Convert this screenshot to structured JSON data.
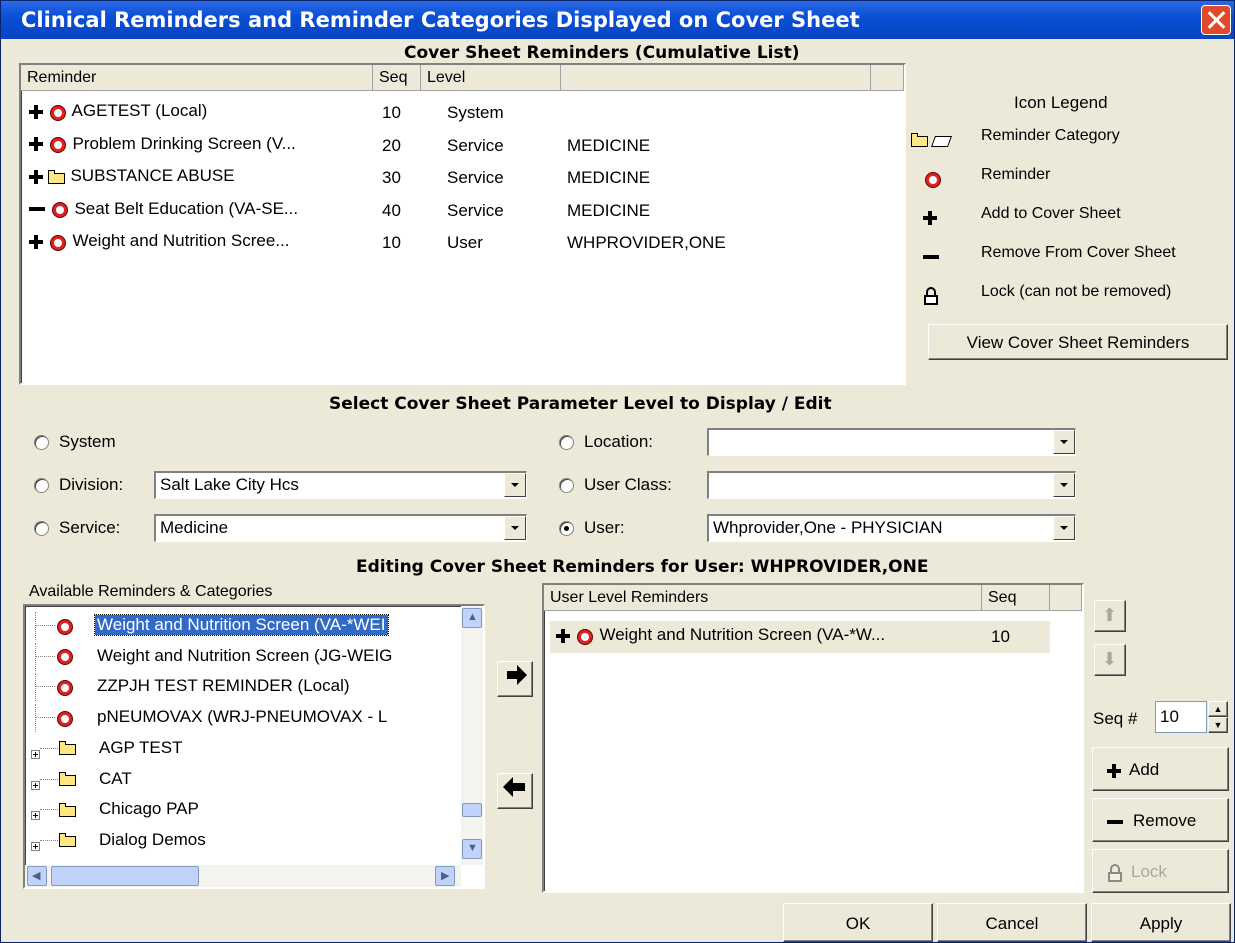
{
  "window": {
    "title": "Clinical Reminders and Reminder Categories Displayed on Cover Sheet"
  },
  "cumulative": {
    "heading": "Cover Sheet Reminders (Cumulative List)",
    "columns": [
      "Reminder",
      "Seq",
      "Level",
      ""
    ],
    "rows": [
      {
        "action": "add",
        "icon": "reminder-clock-icon",
        "name": "AGETEST (Local)",
        "seq": "10",
        "level": "System",
        "value": ""
      },
      {
        "action": "add",
        "icon": "reminder-clock-icon",
        "name": "Problem Drinking Screen (V...",
        "seq": "20",
        "level": "Service",
        "value": "MEDICINE"
      },
      {
        "action": "add",
        "icon": "folder-icon",
        "name": "SUBSTANCE ABUSE",
        "seq": "30",
        "level": "Service",
        "value": "MEDICINE"
      },
      {
        "action": "remove",
        "icon": "reminder-clock-icon",
        "name": "Seat Belt Education (VA-SE...",
        "seq": "40",
        "level": "Service",
        "value": "MEDICINE"
      },
      {
        "action": "add",
        "icon": "reminder-clock-icon",
        "name": "Weight and Nutrition Scree...",
        "seq": "10",
        "level": "User",
        "value": "WHPROVIDER,ONE"
      }
    ]
  },
  "legend": {
    "title": "Icon Legend",
    "items": [
      {
        "icon": "folder-icon",
        "label": "Reminder Category"
      },
      {
        "icon": "reminder-clock-icon",
        "label": "Reminder"
      },
      {
        "icon": "plus-icon",
        "label": "Add to Cover Sheet"
      },
      {
        "icon": "minus-icon",
        "label": "Remove From Cover Sheet"
      },
      {
        "icon": "lock-icon",
        "label": "Lock (can not be removed)"
      }
    ],
    "view_button": "View Cover Sheet Reminders"
  },
  "params": {
    "heading": "Select Cover Sheet Parameter Level to Display / Edit",
    "system_label": "System",
    "division_label": "Division:",
    "division_value": "Salt Lake City Hcs",
    "service_label": "Service:",
    "service_value": "Medicine",
    "location_label": "Location:",
    "location_value": "",
    "userclass_label": "User Class:",
    "userclass_value": "",
    "user_label": "User:",
    "user_value": "Whprovider,One - PHYSICIAN",
    "selected": "User"
  },
  "editing": {
    "heading": "Editing Cover Sheet Reminders for User: WHPROVIDER,ONE",
    "available_label": "Available Reminders & Categories",
    "available": [
      {
        "icon": "reminder-clock-icon",
        "label": "Weight and Nutrition Screen (VA-*WEI",
        "selected": true,
        "expander": false
      },
      {
        "icon": "reminder-clock-icon",
        "label": "Weight and Nutrition Screen (JG-WEIG",
        "selected": false,
        "expander": false
      },
      {
        "icon": "reminder-clock-icon",
        "label": "ZZPJH TEST REMINDER (Local)",
        "selected": false,
        "expander": false
      },
      {
        "icon": "reminder-clock-icon",
        "label": "pNEUMOVAX (WRJ-PNEUMOVAX - L",
        "selected": false,
        "expander": false
      },
      {
        "icon": "folder-icon",
        "label": "AGP TEST",
        "selected": false,
        "expander": true
      },
      {
        "icon": "folder-icon",
        "label": "CAT",
        "selected": false,
        "expander": true
      },
      {
        "icon": "folder-icon",
        "label": "Chicago PAP",
        "selected": false,
        "expander": true
      },
      {
        "icon": "folder-icon",
        "label": "Dialog Demos",
        "selected": false,
        "expander": true
      }
    ],
    "user_level_columns": [
      "User Level Reminders",
      "Seq"
    ],
    "user_level_rows": [
      {
        "action": "add",
        "icon": "reminder-clock-icon",
        "name": "Weight and Nutrition Screen (VA-*W...",
        "seq": "10"
      }
    ],
    "seq_label": "Seq #",
    "seq_value": "10",
    "add_label": "Add",
    "remove_label": "Remove",
    "lock_label": "Lock"
  },
  "footer": {
    "ok": "OK",
    "cancel": "Cancel",
    "apply": "Apply"
  },
  "colors": {
    "title_bar": "#0a4fd6",
    "selection": "#316ac5",
    "window_bg": "#ece9d8"
  }
}
